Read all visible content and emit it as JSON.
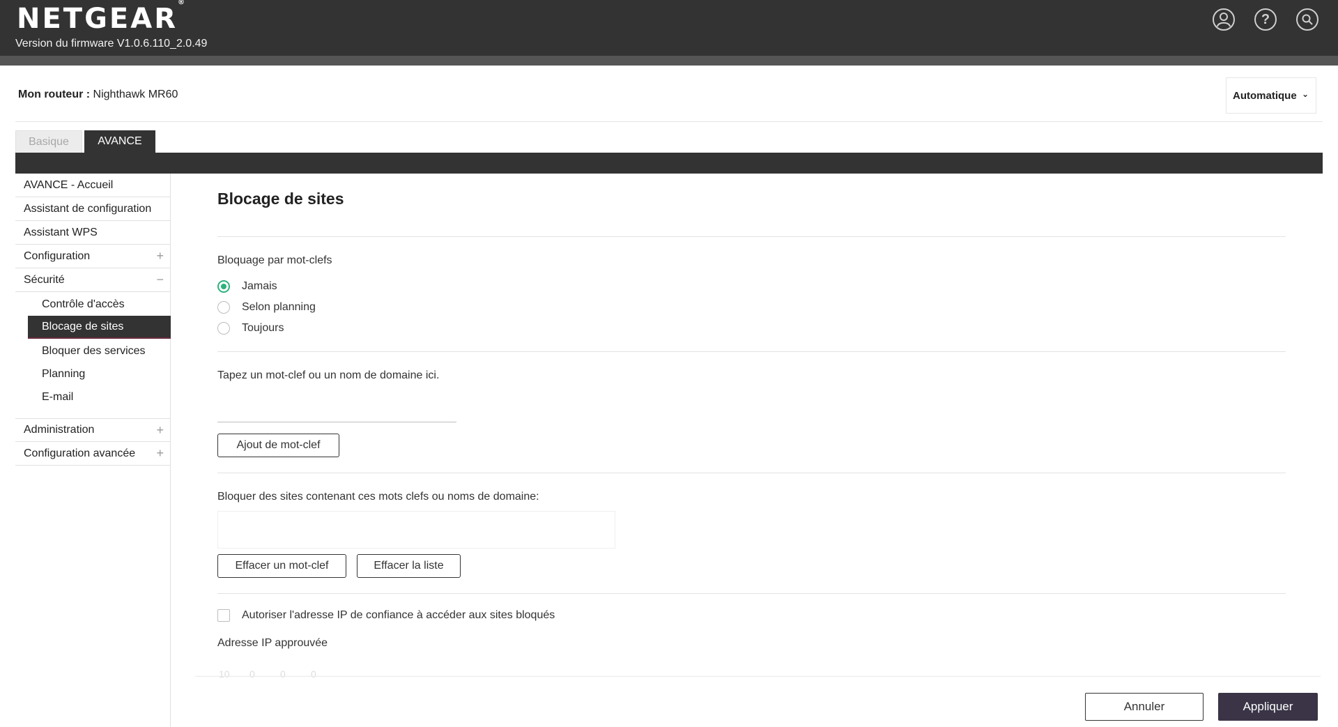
{
  "header": {
    "brand": "NETGEAR",
    "brand_mark": "®",
    "firmware": "Version du firmware V1.0.6.110_2.0.49",
    "icons": [
      "user-account-icon",
      "help-icon",
      "search-icon"
    ]
  },
  "router": {
    "label": "Mon routeur :",
    "model": "Nighthawk MR60"
  },
  "language": {
    "selected": "Automatique"
  },
  "tabs": [
    {
      "label": "Basique",
      "active": false
    },
    {
      "label": "AVANCE",
      "active": true
    }
  ],
  "sidebar": {
    "items": [
      {
        "label": "AVANCE - Accueil"
      },
      {
        "label": "Assistant de configuration"
      },
      {
        "label": "Assistant WPS"
      },
      {
        "label": "Configuration",
        "toggle": "+"
      },
      {
        "label": "Sécurité",
        "toggle": "−"
      },
      {
        "label": "Administration",
        "toggle": "+"
      },
      {
        "label": "Configuration avancée",
        "toggle": "+"
      }
    ],
    "security_sub": [
      {
        "label": "Contrôle d'accès"
      },
      {
        "label": "Blocage de sites",
        "active": true
      },
      {
        "label": "Bloquer des services"
      },
      {
        "label": "Planning"
      },
      {
        "label": "E-mail"
      }
    ]
  },
  "main": {
    "title": "Blocage de sites",
    "keyword_blocking_label": "Bloquage par mot-clefs",
    "radio_options": [
      {
        "label": "Jamais",
        "checked": true
      },
      {
        "label": "Selon planning",
        "checked": false
      },
      {
        "label": "Toujours",
        "checked": false
      }
    ],
    "keyword_prompt": "Tapez un mot-clef ou un nom de domaine ici.",
    "keyword_input_value": "",
    "add_keyword_button": "Ajout de mot-clef",
    "blocked_list_label": "Bloquer des sites contenant ces mots clefs ou noms de domaine:",
    "delete_keyword_button": "Effacer un mot-clef",
    "clear_list_button": "Effacer la liste",
    "trusted_ip_checkbox_label": "Autoriser l'adresse IP de confiance à accéder aux sites bloqués",
    "trusted_ip_checked": false,
    "approved_ip_label": "Adresse IP approuvée",
    "approved_ip_octets": [
      "10",
      "0",
      "0",
      "0"
    ]
  },
  "footer": {
    "cancel": "Annuler",
    "apply": "Appliquer"
  },
  "colors": {
    "header_bg": "#333333",
    "accent_green": "#2db27c",
    "apply_bg": "#3a3446"
  }
}
